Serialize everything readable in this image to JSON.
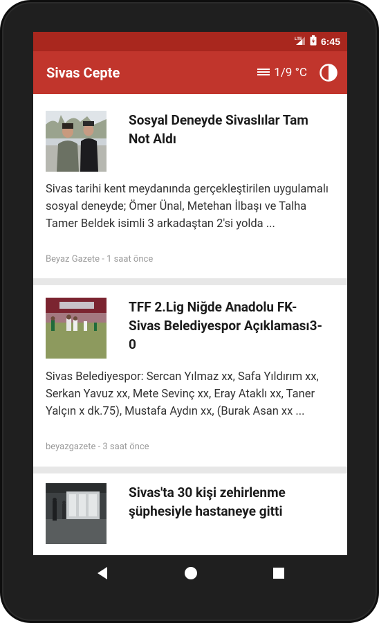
{
  "status_bar": {
    "network": "LTE",
    "time": "6:45"
  },
  "app_bar": {
    "title": "Sivas Cepte",
    "weather_icon": "fog-icon",
    "weather": "1/9 °C",
    "theme_icon": "contrast-icon"
  },
  "articles": [
    {
      "title": "Sosyal Deneyde Sivaslılar Tam Not Aldı",
      "description": "Sivas tarihi kent meydanında gerçekleştirilen uygulamalı sosyal deneyde; Ömer Ünal, Metehan İlbaşı ve Talha Tamer Beldek isimli 3 arkadaştan 2'si yolda ...",
      "meta": "Beyaz Gazete - 1 saat önce"
    },
    {
      "title": "TFF 2.Lig Niğde Anadolu FK- Sivas Belediyespor Açıklaması3-0",
      "description": "Sivas Belediyespor: Sercan Yılmaz xx, Safa Yıldırım xx, Serkan Yavuz xx, Mete Sevinç xx, Eray Ataklı xx, Taner Yalçın x dk.75), Mustafa Aydın xx, (Burak Asan xx ...",
      "meta": "beyazgazete - 3 saat önce"
    },
    {
      "title": "Sivas'ta 30 kişi zehirlenme şüphesiyle hastaneye gitti"
    }
  ],
  "colors": {
    "status_bar": "#a9271e",
    "app_bar": "#c1352c",
    "feed_background": "#e7e7e7"
  }
}
